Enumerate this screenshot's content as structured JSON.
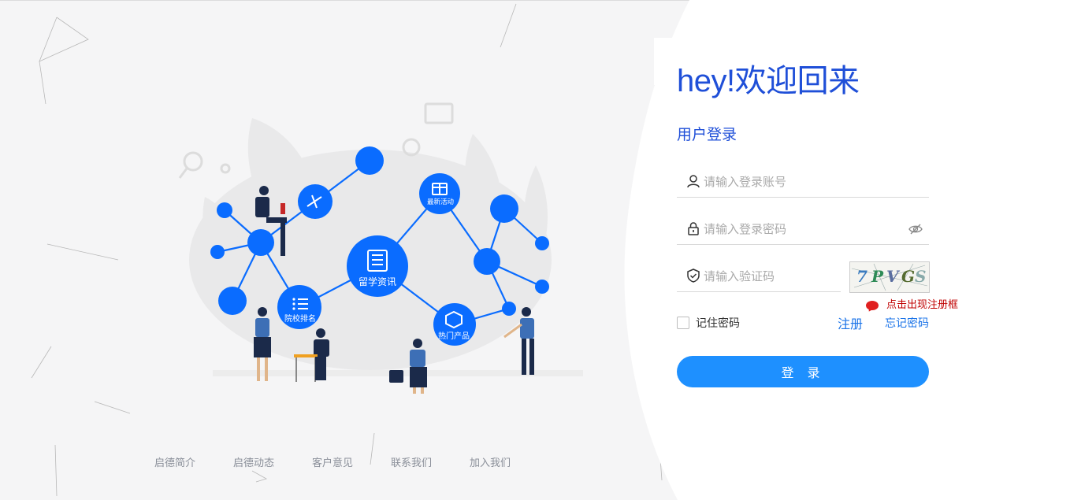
{
  "login": {
    "welcome": "hey!欢迎回来",
    "subtitle": "用户登录",
    "account_placeholder": "请输入登录账号",
    "password_placeholder": "请输入登录密码",
    "captcha_placeholder": "请输入验证码",
    "captcha_text": [
      "7",
      "P",
      "V",
      "G",
      "S"
    ],
    "tip": "点击出现注册框",
    "remember": "记住密码",
    "register": "注册",
    "forgot": "忘记密码",
    "submit": "登 录"
  },
  "illustration": {
    "center": "留学资讯",
    "activity": "最新活动",
    "ranking": "院校排名",
    "products": "热门产品"
  },
  "footer": [
    "启德简介",
    "启德动态",
    "客户意见",
    "联系我们",
    "加入我们"
  ],
  "colors": {
    "brand": "#1f4fd8",
    "button": "#1e90ff",
    "node": "#0a6cff",
    "tip": "#c00000"
  }
}
